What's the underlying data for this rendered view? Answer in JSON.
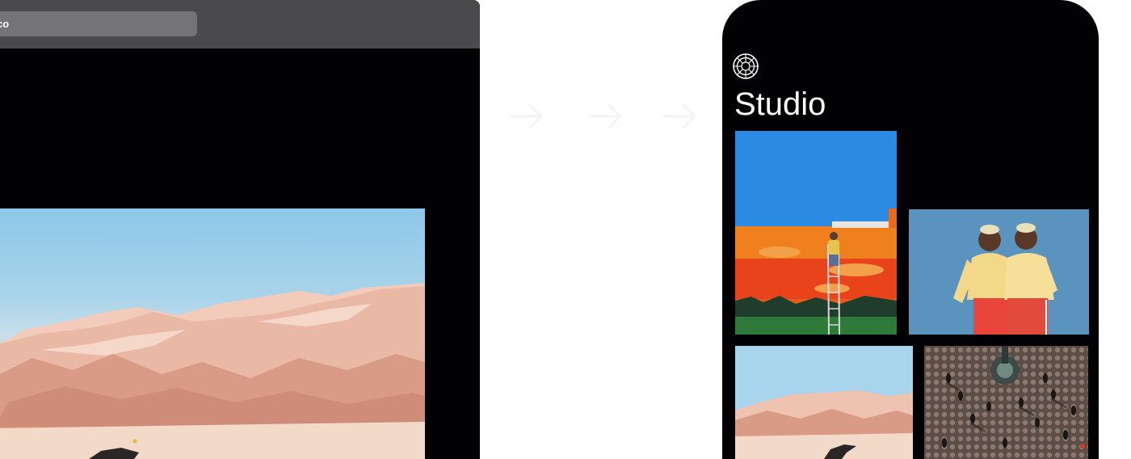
{
  "browser": {
    "address_text": "co"
  },
  "phone": {
    "title": "Studio",
    "logo_icon": "aperture-logo-icon",
    "gallery": [
      {
        "name": "mural-ladder-photo"
      },
      {
        "name": "twins-yellow-sweaters-photo"
      },
      {
        "name": "desert-road-photo"
      },
      {
        "name": "plaza-crowd-aerial-photo"
      }
    ]
  },
  "arrows": [
    "arrow-right-icon",
    "arrow-right-icon",
    "arrow-right-icon"
  ],
  "colors": {
    "page_background": "#ffffff",
    "window_background": "#020104",
    "toolbar": "#4a494b",
    "address_bar": "#747375",
    "title_text": "#ffffff"
  }
}
